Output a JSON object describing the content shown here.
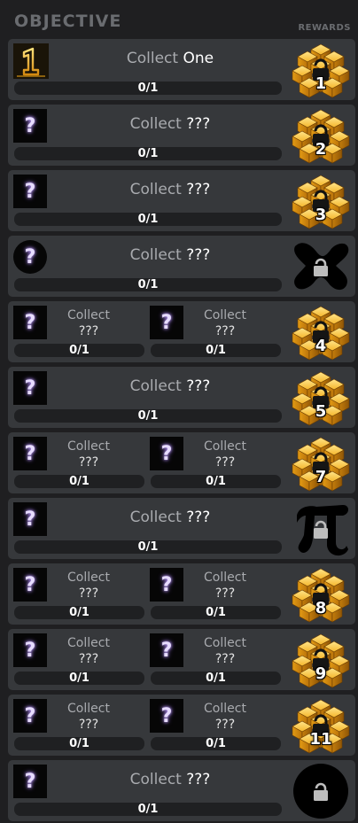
{
  "header": {
    "title": "OBJECTIVE",
    "rewards_label": "REWARDS"
  },
  "objectives": [
    {
      "layout": "single",
      "icon": "gold-one-icon",
      "word1": "Collect",
      "word2": "One",
      "progress": "0/1",
      "reward": {
        "kind": "crate",
        "number": "1"
      }
    },
    {
      "layout": "single",
      "icon": "mystery-square-icon",
      "word1": "Collect",
      "word2": "???",
      "progress": "0/1",
      "reward": {
        "kind": "crate",
        "number": "2"
      }
    },
    {
      "layout": "single",
      "icon": "mystery-square-icon",
      "word1": "Collect",
      "word2": "???",
      "progress": "0/1",
      "reward": {
        "kind": "crate",
        "number": "3"
      }
    },
    {
      "layout": "single",
      "icon": "mystery-circle-icon",
      "word1": "Collect",
      "word2": "???",
      "progress": "0/1",
      "reward": {
        "kind": "locked-shape",
        "shape": "x-blob"
      }
    },
    {
      "layout": "double",
      "items": [
        {
          "word1": "Collect",
          "word2": "???",
          "progress": "0/1"
        },
        {
          "word1": "Collect",
          "word2": "???",
          "progress": "0/1"
        }
      ],
      "reward": {
        "kind": "crate",
        "number": "4"
      }
    },
    {
      "layout": "single",
      "icon": "mystery-square-icon",
      "word1": "Collect",
      "word2": "???",
      "progress": "0/1",
      "reward": {
        "kind": "crate",
        "number": "5"
      }
    },
    {
      "layout": "double",
      "items": [
        {
          "word1": "Collect",
          "word2": "???",
          "progress": "0/1"
        },
        {
          "word1": "Collect",
          "word2": "???",
          "progress": "0/1"
        }
      ],
      "reward": {
        "kind": "crate",
        "number": "7"
      }
    },
    {
      "layout": "single",
      "icon": "mystery-square-icon",
      "word1": "Collect",
      "word2": "???",
      "progress": "0/1",
      "reward": {
        "kind": "locked-shape",
        "shape": "pi"
      }
    },
    {
      "layout": "double",
      "items": [
        {
          "word1": "Collect",
          "word2": "???",
          "progress": "0/1"
        },
        {
          "word1": "Collect",
          "word2": "???",
          "progress": "0/1"
        }
      ],
      "reward": {
        "kind": "crate",
        "number": "8"
      }
    },
    {
      "layout": "double",
      "items": [
        {
          "word1": "Collect",
          "word2": "???",
          "progress": "0/1"
        },
        {
          "word1": "Collect",
          "word2": "???",
          "progress": "0/1"
        }
      ],
      "reward": {
        "kind": "crate",
        "number": "9"
      }
    },
    {
      "layout": "double",
      "items": [
        {
          "word1": "Collect",
          "word2": "???",
          "progress": "0/1"
        },
        {
          "word1": "Collect",
          "word2": "???",
          "progress": "0/1"
        }
      ],
      "reward": {
        "kind": "crate",
        "number": "11"
      }
    },
    {
      "layout": "single",
      "icon": "mystery-square-icon",
      "word1": "Collect",
      "word2": "???",
      "progress": "0/1",
      "reward": {
        "kind": "locked-shape",
        "shape": "circle"
      }
    }
  ],
  "colors": {
    "background": "#1f1f21",
    "row": "#36383b",
    "bar": "#1f2022",
    "crate_gold": "#f2b634",
    "mystery_glow": "#c7a6ff"
  }
}
